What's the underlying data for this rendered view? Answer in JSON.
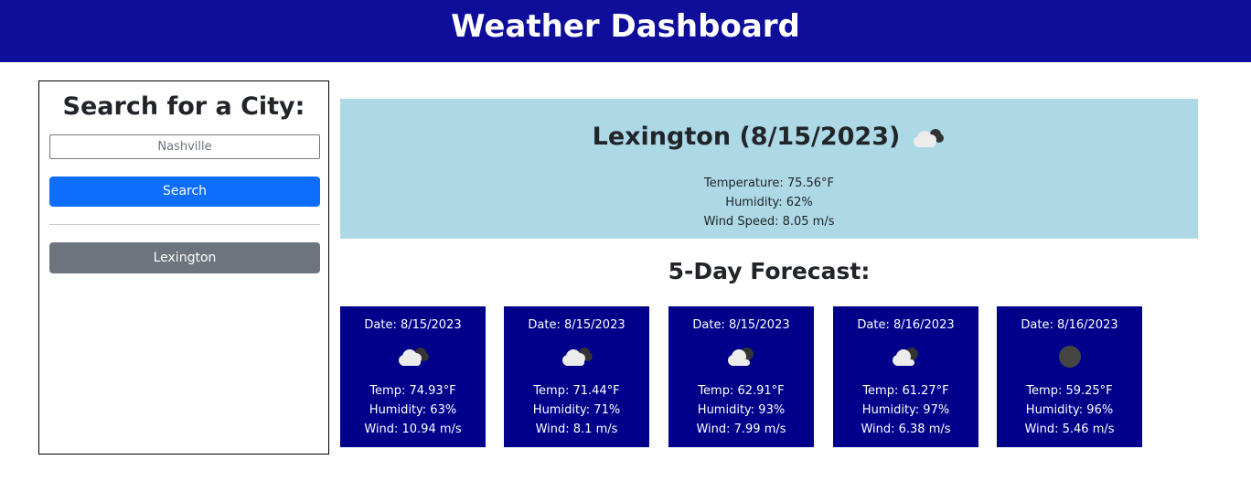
{
  "header": {
    "title": "Weather Dashboard"
  },
  "sidebar": {
    "heading": "Search for a City:",
    "search_placeholder": "Nashville",
    "search_button": "Search",
    "history": [
      "Lexington"
    ]
  },
  "current": {
    "city_date": "Lexington (8/15/2023)",
    "icon": "broken-clouds-icon",
    "temperature": "Temperature: 75.56°F",
    "humidity": "Humidity: 62%",
    "wind": "Wind Speed: 8.05 m/s"
  },
  "forecast": {
    "title": "5-Day Forecast:",
    "days": [
      {
        "date": "Date: 8/15/2023",
        "icon": "broken-clouds-icon",
        "temp": "Temp: 74.93°F",
        "humidity": "Humidity: 63%",
        "wind": "Wind: 10.94 m/s"
      },
      {
        "date": "Date: 8/15/2023",
        "icon": "broken-clouds-icon",
        "temp": "Temp: 71.44°F",
        "humidity": "Humidity: 71%",
        "wind": "Wind: 8.1 m/s"
      },
      {
        "date": "Date: 8/15/2023",
        "icon": "broken-clouds-icon",
        "temp": "Temp: 62.91°F",
        "humidity": "Humidity: 93%",
        "wind": "Wind: 7.99 m/s"
      },
      {
        "date": "Date: 8/16/2023",
        "icon": "broken-clouds-icon",
        "temp": "Temp: 61.27°F",
        "humidity": "Humidity: 97%",
        "wind": "Wind: 6.38 m/s"
      },
      {
        "date": "Date: 8/16/2023",
        "icon": "overcast-clouds-icon",
        "temp": "Temp: 59.25°F",
        "humidity": "Humidity: 96%",
        "wind": "Wind: 5.46 m/s"
      }
    ]
  },
  "colors": {
    "header_bg": "#0e0e9b",
    "search_button": "#0d6efd",
    "history_button": "#6c757d",
    "current_bg": "#add8e6",
    "card_bg": "#00008b"
  }
}
